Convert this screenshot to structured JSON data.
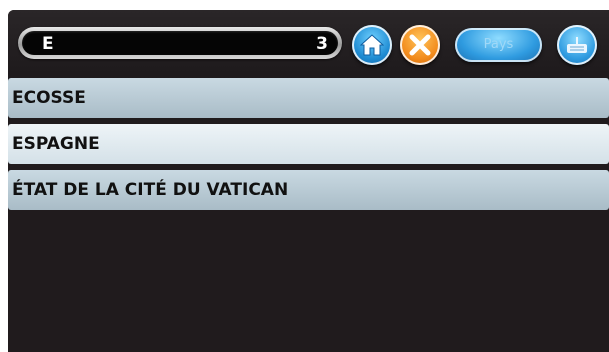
{
  "search": {
    "value": "E",
    "count": "3"
  },
  "toolbar": {
    "home_icon": "home-icon",
    "close_icon": "close-icon",
    "pays_label": "Pays",
    "keyboard_icon": "keyboard-icon"
  },
  "colors": {
    "background": "#201b1d",
    "item_dark": "#b6c8d2",
    "item_light": "#e3ecf1",
    "home_accent": "#1e8bd2",
    "close_accent": "#f28b1c"
  },
  "list": {
    "items": [
      {
        "label": "ECOSSE"
      },
      {
        "label": "ESPAGNE"
      },
      {
        "label": "ÉTAT DE LA CITÉ DU VATICAN"
      }
    ]
  }
}
